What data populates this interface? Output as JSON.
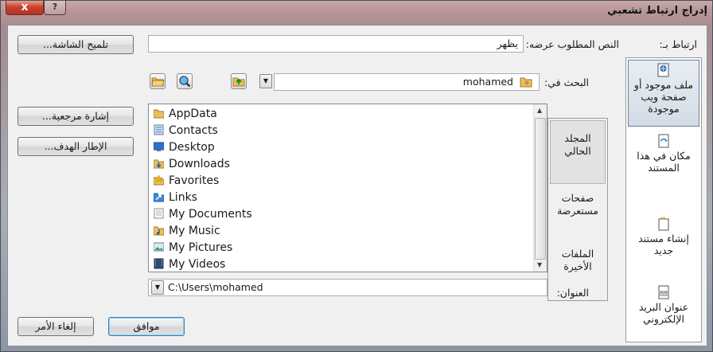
{
  "window": {
    "title": "إدراج ارتباط تشعبي",
    "close_glyph": "x",
    "help_glyph": "?"
  },
  "link_to": {
    "label": "ارتباط بـ:",
    "items": [
      {
        "label": "ملف موجود أو صفحة ويب موجودة",
        "icon": "web-page-icon",
        "selected": true
      },
      {
        "label": "مكان في هذا المستند",
        "icon": "document-place-icon",
        "selected": false
      },
      {
        "label": "إنشاء مستند جديد",
        "icon": "new-document-icon",
        "selected": false
      },
      {
        "label": "عنوان البريد الإلكتروني",
        "icon": "email-icon",
        "selected": false
      }
    ]
  },
  "text_to_display": {
    "label": "النص المطلوب عرضه:",
    "value": "يظهر"
  },
  "screentip_button": "تلميح الشاشة...",
  "look_in": {
    "label": "البحث في:",
    "value": "mohamed"
  },
  "bookmark_button": "إشارة مرجعية...",
  "target_frame_button": "الإطار الهدف...",
  "views": [
    {
      "label": "المجلد الحالي",
      "selected": true
    },
    {
      "label": "صفحات مستعرضة",
      "selected": false
    },
    {
      "label": "الملفات الأخيرة",
      "selected": false
    }
  ],
  "files": [
    {
      "name": "AppData",
      "icon": "folder-icon"
    },
    {
      "name": "Contacts",
      "icon": "contacts-folder-icon"
    },
    {
      "name": "Desktop",
      "icon": "desktop-folder-icon"
    },
    {
      "name": "Downloads",
      "icon": "downloads-folder-icon"
    },
    {
      "name": "Favorites",
      "icon": "favorites-folder-icon"
    },
    {
      "name": "Links",
      "icon": "links-folder-icon"
    },
    {
      "name": "My Documents",
      "icon": "documents-folder-icon"
    },
    {
      "name": "My Music",
      "icon": "music-folder-icon"
    },
    {
      "name": "My Pictures",
      "icon": "pictures-folder-icon"
    },
    {
      "name": "My Videos",
      "icon": "videos-folder-icon"
    }
  ],
  "address": {
    "label": "العنوان:",
    "value": "C:\\Users\\mohamed"
  },
  "ok_button": "موافق",
  "cancel_button": "إلغاء الأمر",
  "colors": {
    "folder": "#e8c060",
    "selection_border": "#6b7f99",
    "close_red": "#c9432f"
  }
}
